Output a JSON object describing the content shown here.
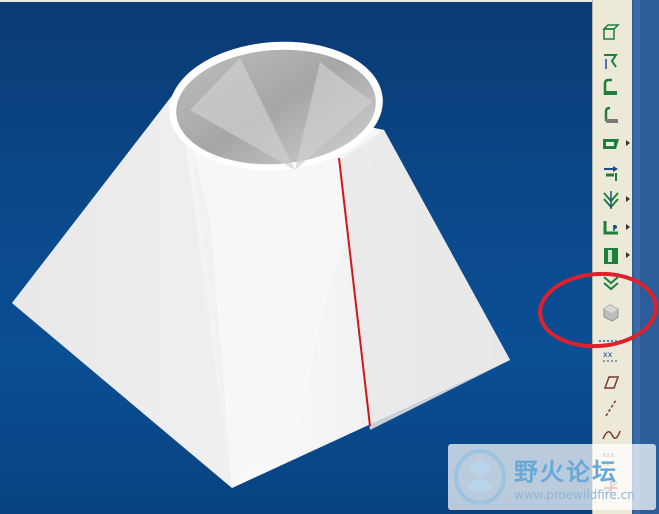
{
  "viewport": {
    "model_name": "cone-to-square transition"
  },
  "toolbar": {
    "buttons": [
      {
        "icon": "datum-plane-icon",
        "has_flyout": false
      },
      {
        "icon": "datum-axis-icon",
        "has_flyout": false
      },
      {
        "icon": "sheetmetal-wall-icon",
        "has_flyout": false
      },
      {
        "icon": "flange-wall-icon",
        "has_flyout": false
      },
      {
        "icon": "extend-wall-icon",
        "has_flyout": true
      },
      {
        "icon": "rip-icon",
        "has_flyout": false
      },
      {
        "icon": "bend-icon",
        "has_flyout": true
      },
      {
        "icon": "unbend-icon",
        "has_flyout": true
      },
      {
        "icon": "form-icon",
        "has_flyout": true
      },
      {
        "icon": "flatten-icon",
        "has_flyout": false
      },
      {
        "icon": "corner-relief-icon",
        "has_flyout": false
      },
      {
        "icon": "datum-point-icon",
        "has_flyout": false
      },
      {
        "icon": "sketch-plane-icon",
        "has_flyout": false
      },
      {
        "icon": "sketch-line-icon",
        "has_flyout": false
      },
      {
        "icon": "sketch-curve-icon",
        "has_flyout": false
      },
      {
        "icon": "csys-icon",
        "has_flyout": false
      },
      {
        "icon": "coordinate-icon",
        "has_flyout": false
      }
    ],
    "highlighted_button": "corner-relief-icon"
  },
  "watermark": {
    "title": "野火论坛",
    "url": "www.proewildfire.cn"
  },
  "colors": {
    "viewport_background": "#0b4a8c",
    "toolbar_background": "#ece9d8",
    "highlight": "#e0202a",
    "seam_line": "#d01818"
  }
}
